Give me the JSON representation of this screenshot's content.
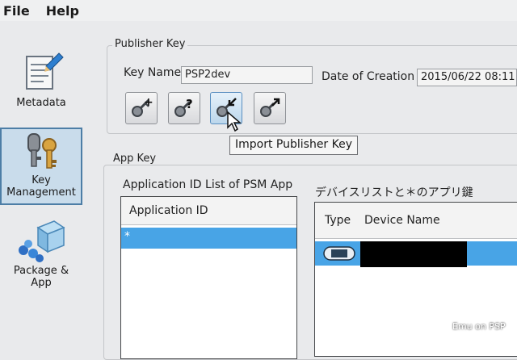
{
  "menu": {
    "file": "File",
    "help": "Help"
  },
  "nav": {
    "metadata": "Metadata",
    "key_management_line1": "Key",
    "key_management_line2": "Management",
    "package_line1": "Package &",
    "package_line2": "App"
  },
  "publisher_key": {
    "title": "Publisher Key",
    "key_name_label": "Key Name",
    "key_name_value": "PSP2dev",
    "date_label": "Date of Creation",
    "date_value": "2015/06/22 08:11:"
  },
  "toolbar": {
    "buttons": [
      {
        "icon": "key-add-icon"
      },
      {
        "icon": "key-query-icon"
      },
      {
        "icon": "key-import-icon"
      },
      {
        "icon": "key-export-icon"
      }
    ],
    "tooltip": "Import Publisher Key"
  },
  "app_key": {
    "title": "App Key",
    "app_list_label": "Application ID List of PSM App",
    "app_list_header": "Application ID",
    "app_list_rows": [
      "*"
    ],
    "device_list_label": "デバイスリストと＊のアプリ鍵",
    "device_headers": [
      "Type",
      "Device Name"
    ]
  },
  "colors": {
    "selection": "#48a4e6",
    "nav_selected_bg": "#c9dceb",
    "nav_selected_border": "#4d7ea6"
  },
  "watermark": "Emu on PSP"
}
